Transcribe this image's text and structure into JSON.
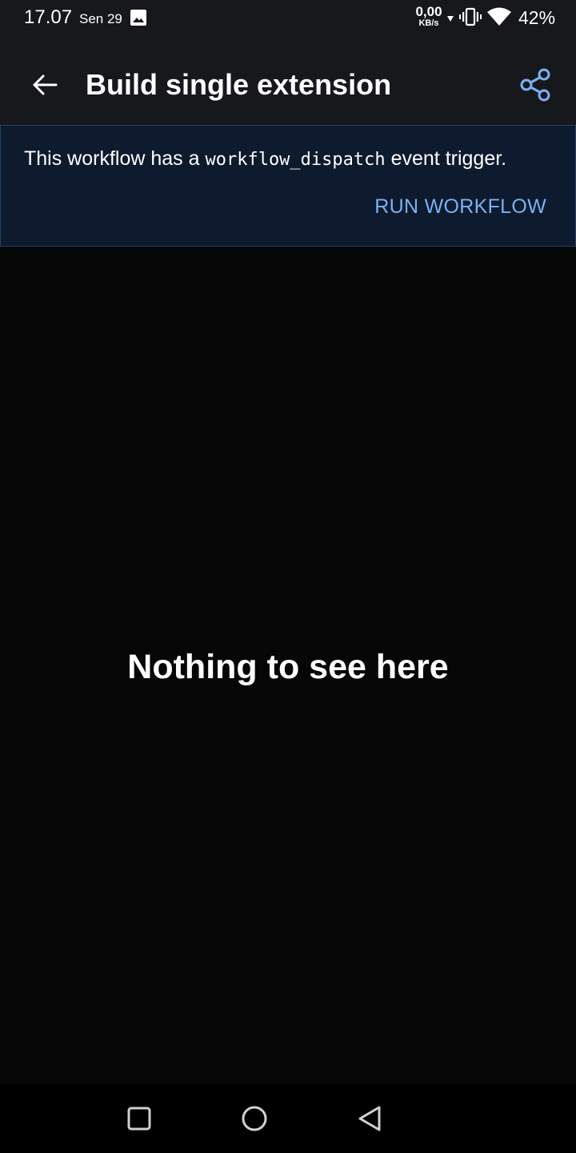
{
  "status_bar": {
    "time": "17.07",
    "date": "Sen 29",
    "net_speed_value": "0,00",
    "net_speed_unit": "KB/s",
    "battery": "42%"
  },
  "header": {
    "title": "Build single extension"
  },
  "banner": {
    "text_before": "This workflow has a ",
    "code": "workflow_dispatch",
    "text_after": " event trigger.",
    "action_label": "RUN WORKFLOW"
  },
  "main": {
    "empty_message": "Nothing to see here"
  },
  "colors": {
    "app_bar": "#17181c",
    "background": "#060606",
    "banner_bg": "#0e1a2e",
    "banner_border": "#23416b",
    "accent": "#7ab1f3"
  }
}
